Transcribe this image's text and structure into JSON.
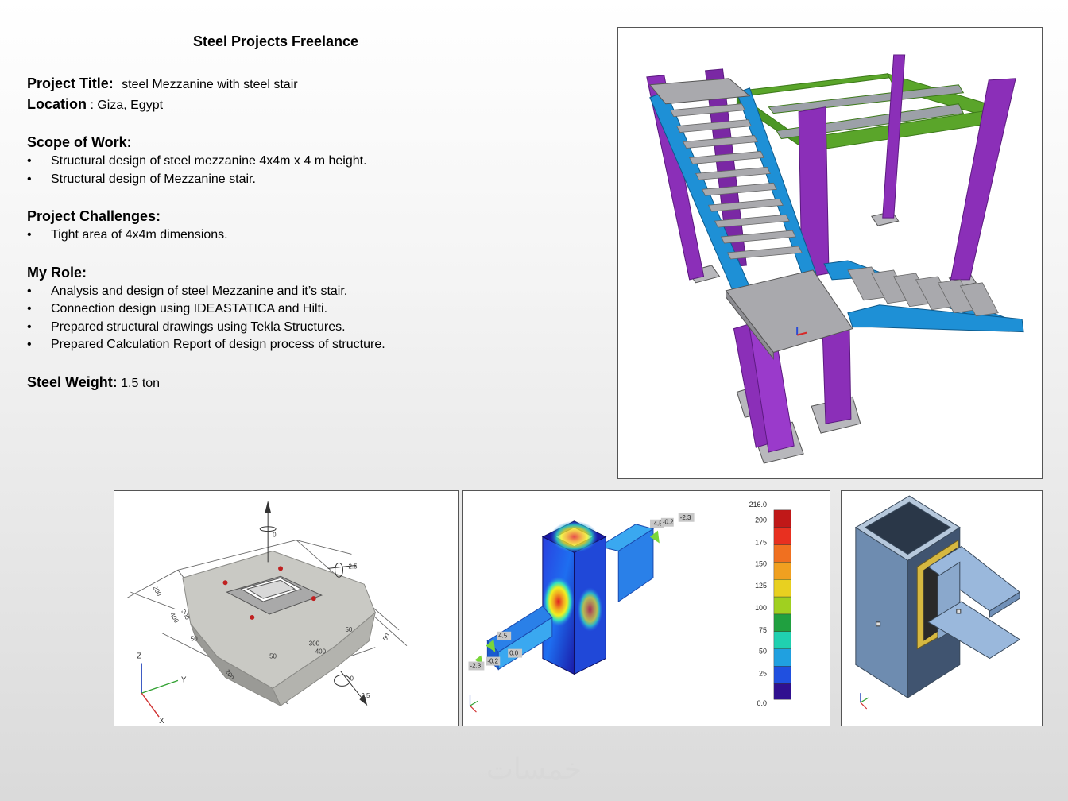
{
  "page_title": "Steel Projects Freelance",
  "project_title": {
    "label": "Project Title:",
    "value": "steel Mezzanine with steel stair"
  },
  "location": {
    "label": "Location",
    "value": ": Giza, Egypt"
  },
  "scope": {
    "heading": "Scope of Work:",
    "items": [
      "Structural design of steel mezzanine 4x4m  x 4 m height.",
      "Structural design of Mezzanine stair."
    ]
  },
  "challenges": {
    "heading": "Project Challenges:",
    "items": [
      "Tight area of 4x4m dimensions."
    ]
  },
  "role": {
    "heading": "My Role:",
    "items": [
      "Analysis and design of steel Mezzanine and it’s stair.",
      "Connection design using IDEASTATICA and Hilti.",
      "Prepared structural drawings using Tekla Structures.",
      "Prepared Calculation Report of design process of structure."
    ]
  },
  "weight": {
    "label": "Steel Weight:",
    "value": "1.5 ton"
  },
  "bullet_char": "•",
  "base_plate_labels": {
    "z": "Z",
    "y": "Y",
    "x": "X",
    "dims": [
      "300",
      "400",
      "50",
      "200",
      "50",
      "400",
      "300",
      "50",
      "200",
      "50"
    ],
    "moments": [
      "0",
      "2.5",
      "0",
      "2.5"
    ]
  },
  "stress_legend": {
    "ticks": [
      "216.0",
      "200",
      "175",
      "150",
      "125",
      "100",
      "75",
      "50",
      "25",
      "0.0"
    ],
    "tags": [
      "-4.5",
      "-0.2",
      "-2.3",
      "4.5",
      "0.0",
      "-0.2",
      "-2.3"
    ]
  },
  "watermark": "خمسات",
  "colors": {
    "column_purple": "#8b2fb8",
    "stair_blue": "#1e90d6",
    "beam_green": "#5aa52a",
    "plate_grey": "#a9a9ad"
  }
}
